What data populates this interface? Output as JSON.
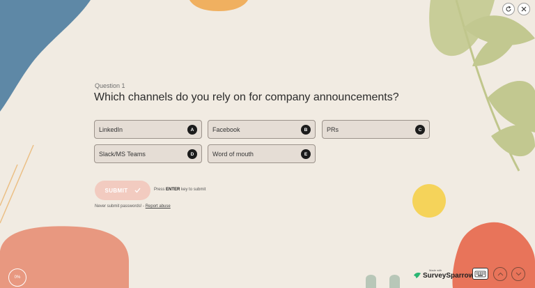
{
  "top_actions": {
    "refresh_icon": "refresh-icon",
    "close_icon": "close-icon"
  },
  "question": {
    "number_label": "Question 1",
    "title": "Which channels do you rely on for company announcements?"
  },
  "options": [
    {
      "label": "LinkedIn",
      "key": "A"
    },
    {
      "label": "Facebook",
      "key": "B"
    },
    {
      "label": "PRs",
      "key": "C"
    },
    {
      "label": "Slack/MS Teams",
      "key": "D"
    },
    {
      "label": "Word of mouth",
      "key": "E"
    }
  ],
  "submit": {
    "label": "SUBMIT",
    "icon": "check-icon"
  },
  "hint": {
    "prefix": "Press",
    "key": "ENTER",
    "suffix": "key to submit"
  },
  "warning": {
    "text": "Never submit passwords! -",
    "link": "Report abuse"
  },
  "progress": {
    "label": "0%",
    "value": 0
  },
  "branding": {
    "made_with": "Made with",
    "name": "SurveySparrow"
  },
  "footer": {
    "keyboard_icon": "keyboard-icon",
    "up_icon": "chevron-up-icon",
    "down_icon": "chevron-down-icon"
  },
  "colors": {
    "background": "#f1ebe2",
    "blue_shape": "#5e88a6",
    "orange_shape": "#f0b060",
    "green_leaves": "#c2c890",
    "coral_shape": "#e8745a",
    "pink_shape": "#e89880",
    "yellow_circle": "#f5d35a",
    "submit_button": "#f2cbc0"
  }
}
